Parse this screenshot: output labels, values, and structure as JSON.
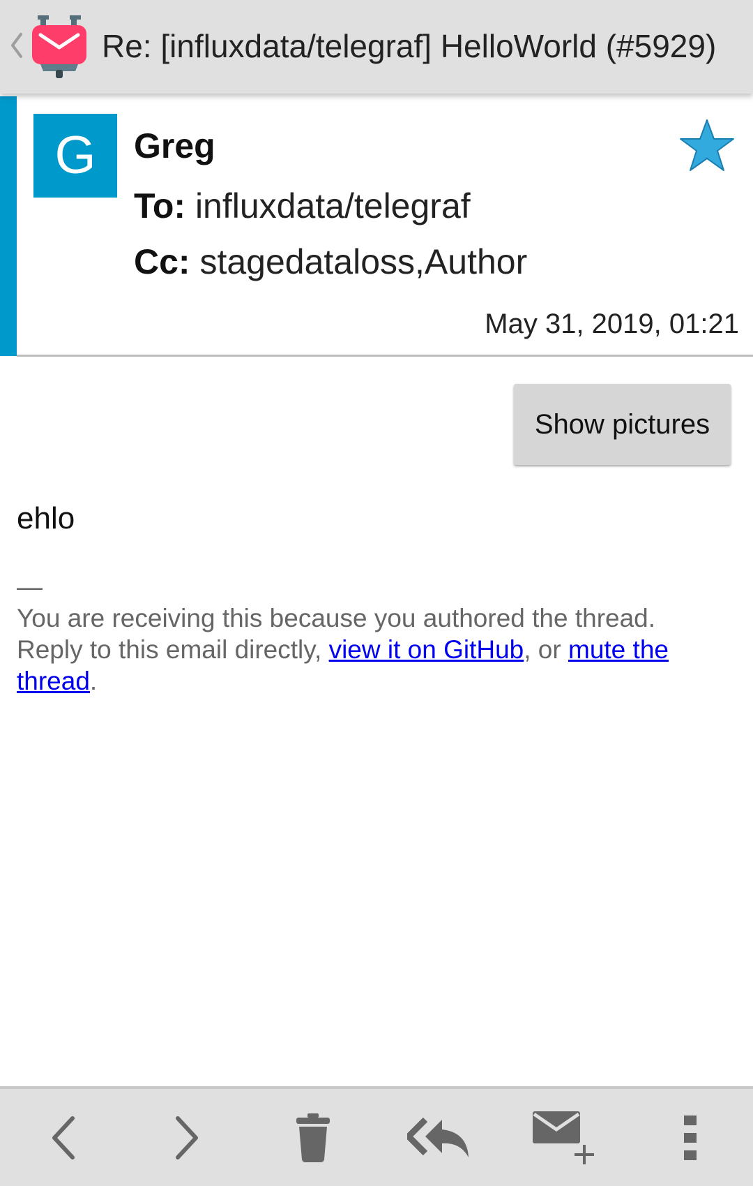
{
  "appbar": {
    "title": "Re: [influxdata/telegraf] HelloWorld (#5929)",
    "back_icon": "chevron-left-icon",
    "app_icon": "k9-mail-logo-icon"
  },
  "message": {
    "avatar_letter": "G",
    "sender": "Greg",
    "to_label": "To:",
    "to_value": "influxdata/telegraf",
    "cc_label": "Cc:",
    "cc_value": "stagedataloss,Author",
    "date": "May 31, 2019, 01:21",
    "starred": true
  },
  "body": {
    "show_pictures_label": "Show pictures",
    "text": "ehlo",
    "separator": "—",
    "footer_line1": "You are receiving this because you authored the thread.",
    "footer_prefix": "Reply to this email directly, ",
    "link_github": "view it on GitHub",
    "footer_mid": ", or ",
    "link_mute": "mute the thread",
    "footer_end": "."
  },
  "toolbar": {
    "items": [
      "previous-icon",
      "next-icon",
      "delete-icon",
      "reply-all-icon",
      "compose-icon",
      "overflow-menu-icon"
    ]
  },
  "colors": {
    "accent": "#0099cc",
    "appbar_bg": "#e0e0e0",
    "link": "#0000ee",
    "star": "#33aadd"
  }
}
